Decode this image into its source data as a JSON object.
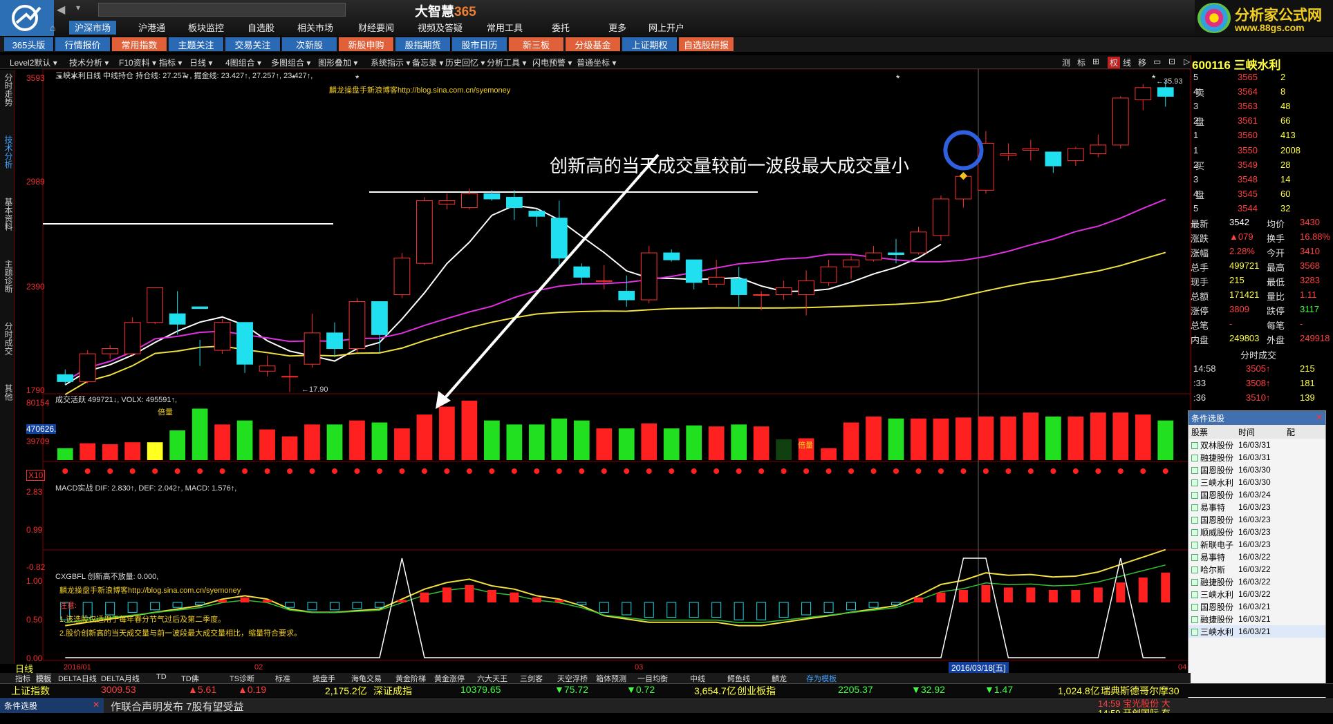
{
  "app": {
    "title_a": "大智慧",
    "title_b": "365"
  },
  "brand": {
    "line1": "分析家公式网",
    "line2": "www.88gs.com"
  },
  "top_menu": [
    "沪深市场",
    "沪港通",
    "板块监控",
    "自选股",
    "相关市场",
    "财经要闻",
    "视频及答疑",
    "常用工具",
    "委托",
    "更多",
    "网上开户"
  ],
  "tabs": [
    {
      "label": "365头版",
      "style": "b"
    },
    {
      "label": "行情报价",
      "style": "b"
    },
    {
      "label": "常用指数",
      "style": "o"
    },
    {
      "label": "主题关注",
      "style": "b"
    },
    {
      "label": "交易关注",
      "style": "b"
    },
    {
      "label": "次新股",
      "style": "b"
    },
    {
      "label": "新股申购",
      "style": "o"
    },
    {
      "label": "股指期货",
      "style": "b"
    },
    {
      "label": "股市日历",
      "style": "b"
    },
    {
      "label": "新三板",
      "style": "o"
    },
    {
      "label": "分级基金",
      "style": "o"
    },
    {
      "label": "上证期权",
      "style": "b"
    },
    {
      "label": "自选股研报",
      "style": "o"
    }
  ],
  "toolbar": [
    "Level2默认",
    "技术分析",
    "F10资料",
    "指标",
    "日线",
    "4图组合",
    "多图组合",
    "图形叠加",
    "系统指示",
    "备忘录",
    "历史回忆",
    "分析工具",
    "闪电预警",
    "普通坐标"
  ],
  "toolbar_right": [
    "测",
    "标",
    "⊞",
    "权",
    "线",
    "移",
    "▭",
    "⊡",
    "▷"
  ],
  "side_tabs": [
    "分时走势",
    "技术分析",
    "基本资料",
    "主题诊断",
    "分时成交",
    "其他"
  ],
  "price_chart": {
    "header": "三峡水利日线 中线持仓  持仓线: 27.257↑, 掘金线: 23.427↑, 27.257↑, 23.427↑,",
    "blog": "麟龙操盘手新浪博客http://blog.sina.com.cn/syemoney",
    "annotation": "创新高的当天成交量较前一波段最大成交量小",
    "y_labels": [
      "3593",
      "2989",
      "2390",
      "1790"
    ],
    "low_label": "←17.90",
    "high_label": "←35.93"
  },
  "volume_chart": {
    "header": "成交活跃 499721↓, VOLX: 495591↑,",
    "y_labels": [
      "80154",
      "470626.",
      "39709",
      "X10"
    ],
    "marker": "倍量",
    "marker2": "倍量"
  },
  "macd_chart": {
    "header": "MACD实战 DIF: 2.830↑, DEF: 2.042↑, MACD: 1.576↑,",
    "y_labels": [
      "2.83",
      "0.99",
      "-0.82"
    ]
  },
  "signal_chart": {
    "header": "CXGBFL 创新高不放量: 0.000,",
    "blog": "麟龙操盘手新浪博客http://blog.sina.com.cn/syemoney",
    "notes": [
      "注意:",
      "1.该选股仅适用于每年春分节气过后及第二季度。",
      "2.股价创新高的当天成交量与前一波段最大成交量相比，缩量符合要求。"
    ],
    "y_labels": [
      "1.00",
      "0.50",
      "0.00"
    ]
  },
  "date_axis": {
    "label": "日线",
    "ticks": [
      "2016/01",
      "02",
      "03"
    ],
    "cursor": "2016/03/18[五]",
    "end": "04"
  },
  "chart_data": {
    "type": "candlestick",
    "title": "三峡水利日线",
    "ylim": [
      17.9,
      35.93
    ],
    "candles": [
      [
        19.0,
        19.3,
        18.4,
        18.6
      ],
      [
        18.6,
        20.4,
        18.5,
        20.2
      ],
      [
        20.2,
        20.7,
        19.9,
        20.5
      ],
      [
        20.2,
        22.3,
        20.1,
        22.0
      ],
      [
        22.0,
        24.0,
        21.9,
        24.0
      ],
      [
        22.5,
        23.8,
        21.3,
        21.9
      ],
      [
        22.9,
        21.0,
        19.5,
        22.8
      ],
      [
        20.4,
        22.2,
        20.2,
        22.0
      ],
      [
        22.0,
        21.2,
        19.1,
        19.6
      ],
      [
        19.2,
        20.1,
        18.9,
        19.5
      ],
      [
        18.9,
        19.6,
        18.0,
        18.9
      ],
      [
        19.6,
        22.5,
        19.4,
        21.4
      ],
      [
        21.4,
        22.0,
        20.0,
        20.5
      ],
      [
        20.5,
        23.4,
        20.3,
        23.2
      ],
      [
        23.2,
        23.0,
        20.3,
        21.3
      ],
      [
        23.6,
        26.0,
        23.4,
        25.7
      ],
      [
        25.4,
        29.2,
        25.3,
        29.0
      ],
      [
        28.8,
        29.4,
        28.5,
        29.0
      ],
      [
        28.6,
        29.7,
        28.5,
        29.4
      ],
      [
        29.4,
        29.6,
        29.0,
        29.1
      ],
      [
        29.2,
        29.6,
        27.9,
        28.6
      ],
      [
        28.4,
        28.5,
        27.5,
        28.1
      ],
      [
        28.0,
        29.0,
        25.2,
        25.7
      ],
      [
        25.2,
        25.4,
        24.2,
        24.6
      ],
      [
        24.4,
        25.3,
        23.9,
        24.4
      ],
      [
        23.8,
        24.7,
        22.9,
        23.3
      ],
      [
        23.3,
        26.4,
        23.1,
        26.0
      ],
      [
        26.0,
        26.2,
        25.5,
        25.6
      ],
      [
        25.6,
        25.5,
        23.9,
        24.3
      ],
      [
        24.2,
        25.6,
        24.0,
        24.6
      ],
      [
        24.5,
        25.2,
        22.9,
        23.6
      ],
      [
        23.6,
        23.8,
        22.7,
        23.6
      ],
      [
        23.6,
        24.4,
        23.3,
        24.0
      ],
      [
        23.6,
        25.0,
        22.4,
        24.4
      ],
      [
        24.3,
        25.6,
        24.1,
        25.2
      ],
      [
        25.2,
        25.8,
        24.5,
        25.6
      ],
      [
        25.6,
        26.4,
        25.5,
        26.0
      ],
      [
        26.0,
        26.8,
        25.4,
        25.9
      ],
      [
        26.0,
        27.5,
        25.9,
        27.2
      ],
      [
        27.0,
        29.3,
        26.7,
        29.1
      ],
      [
        29.1,
        30.4,
        28.6,
        30.4
      ],
      [
        29.6,
        33.0,
        29.4,
        32.3
      ],
      [
        31.6,
        32.3,
        31.3,
        31.7
      ],
      [
        31.9,
        32.5,
        31.3,
        32.0
      ],
      [
        31.8,
        31.8,
        30.6,
        31.0
      ],
      [
        31.3,
        32.1,
        31.0,
        32.0
      ],
      [
        31.7,
        32.8,
        31.5,
        32.2
      ],
      [
        32.2,
        35.0,
        32.0,
        34.9
      ],
      [
        34.8,
        35.7,
        34.2,
        35.5
      ],
      [
        35.5,
        35.93,
        34.4,
        35.0
      ]
    ],
    "volume": [
      12,
      17,
      16,
      18,
      18,
      30,
      52,
      36,
      40,
      31,
      24,
      36,
      36,
      40,
      38,
      32,
      46,
      54,
      60,
      40,
      36,
      36,
      42,
      40,
      32,
      32,
      37,
      32,
      35,
      34,
      36,
      34,
      21,
      22,
      12,
      38,
      44,
      42,
      42,
      42,
      43,
      44,
      44,
      48,
      44,
      44,
      48,
      48,
      46,
      40
    ],
    "macd_hist": [
      -0.7,
      -0.6,
      -0.5,
      -0.4,
      -0.3,
      -0.2,
      -0.1,
      0.1,
      0.2,
      0.1,
      -0.2,
      -0.3,
      -0.3,
      -0.25,
      -0.2,
      0.1,
      0.4,
      0.6,
      0.7,
      0.5,
      0.4,
      0.2,
      0.1,
      -0.1,
      -0.4,
      -0.5,
      -0.6,
      -0.6,
      -0.6,
      -0.6,
      -0.7,
      -0.7,
      -0.6,
      -0.5,
      -0.4,
      -0.3,
      -0.2,
      -0.1,
      0.2,
      0.4,
      0.5,
      0.7,
      0.6,
      0.6,
      0.5,
      0.5,
      0.6,
      0.8,
      1.0,
      1.2
    ],
    "signal": [
      0,
      0,
      0,
      0,
      0,
      0,
      0,
      0,
      0,
      0,
      0,
      0,
      0,
      0,
      0,
      1,
      0,
      0,
      0,
      0,
      0,
      0,
      0,
      0,
      0,
      0,
      0,
      0,
      0,
      0,
      0,
      0,
      0,
      0,
      0,
      0,
      0,
      0,
      0,
      0,
      1,
      1,
      0,
      0,
      0,
      0,
      0,
      1,
      0,
      0
    ]
  },
  "quote": {
    "code": "600116 三峡水利",
    "sell": [
      [
        "5",
        "3565",
        "2"
      ],
      [
        "4",
        "3564",
        "8"
      ],
      [
        "3",
        "3563",
        "48"
      ],
      [
        "2",
        "3561",
        "66"
      ],
      [
        "1",
        "3560",
        "413"
      ]
    ],
    "buy": [
      [
        "1",
        "3550",
        "2008"
      ],
      [
        "2",
        "3549",
        "28"
      ],
      [
        "3",
        "3548",
        "14"
      ],
      [
        "4",
        "3545",
        "60"
      ],
      [
        "5",
        "3544",
        "32"
      ]
    ],
    "sell_label": "卖 盘",
    "buy_label": "买 盘",
    "stats": [
      [
        "最新",
        "3542",
        "均价",
        "3430"
      ],
      [
        "涨跌",
        "▲079",
        "换手",
        "16.88%"
      ],
      [
        "涨幅",
        "2.28%",
        "今开",
        "3410"
      ],
      [
        "总手",
        "499721",
        "最高",
        "3568"
      ],
      [
        "现手",
        "215",
        "最低",
        "3283"
      ],
      [
        "总额",
        "171421",
        "量比",
        "1.11"
      ],
      [
        "涨停",
        "3809",
        "跌停",
        "3117"
      ],
      [
        "总笔",
        "-",
        "每笔",
        "-"
      ],
      [
        "内盘",
        "249803",
        "外盘",
        "249918"
      ]
    ],
    "ticks_header": "分时成交",
    "ticks": [
      [
        "14:58",
        "3505↑",
        "215"
      ],
      [
        ":33",
        "3508↑",
        "181"
      ],
      [
        ":36",
        "3510↑",
        "139"
      ]
    ]
  },
  "cond_panel": {
    "title": "条件选股",
    "cols": [
      "股票",
      "时间",
      "配"
    ],
    "rows": [
      [
        "双林股份",
        "16/03/31"
      ],
      [
        "融捷股份",
        "16/03/31"
      ],
      [
        "国恩股份",
        "16/03/30"
      ],
      [
        "三峡水利",
        "16/03/30"
      ],
      [
        "国恩股份",
        "16/03/24"
      ],
      [
        "易事特",
        "16/03/23"
      ],
      [
        "国恩股份",
        "16/03/23"
      ],
      [
        "顺威股份",
        "16/03/23"
      ],
      [
        "新联电子",
        "16/03/23"
      ],
      [
        "易事特",
        "16/03/22"
      ],
      [
        "哈尔斯",
        "16/03/22"
      ],
      [
        "融捷股份",
        "16/03/22"
      ],
      [
        "三峡水利",
        "16/03/22"
      ],
      [
        "国恩股份",
        "16/03/21"
      ],
      [
        "融捷股份",
        "16/03/21"
      ],
      [
        "三峡水利",
        "16/03/21"
      ]
    ]
  },
  "bottom_tabs": [
    "指标",
    "模板",
    "DELTA日线",
    "DELTA月线",
    "TD",
    "TD佛",
    "TS诊断",
    "标准",
    "操盘手",
    "海龟交易",
    "黄金阶梯",
    "黄金涨停",
    "六大天王",
    "三剑客",
    "天空浮桥",
    "箱体预测",
    "一目均衡",
    "中线",
    "鳄鱼线",
    "麟龙",
    "存为模板"
  ],
  "index_bar": [
    {
      "t": "上证指数",
      "c": "#ffff40"
    },
    {
      "t": "3009.53",
      "c": "#ff4040"
    },
    {
      "t": "▲5.61",
      "c": "#ff4040"
    },
    {
      "t": "▲0.19",
      "c": "#ff4040"
    },
    {
      "t": "2,175.2亿",
      "c": "#ffff40"
    },
    {
      "t": "深证成指",
      "c": "#ffff40"
    },
    {
      "t": "10379.65",
      "c": "#40ff40"
    },
    {
      "t": "▼75.72",
      "c": "#40ff40"
    },
    {
      "t": "▼0.72",
      "c": "#40ff40"
    },
    {
      "t": "3,654.7亿",
      "c": "#ffff40"
    },
    {
      "t": "创业板指",
      "c": "#ffff40"
    },
    {
      "t": "2205.37",
      "c": "#40ff40"
    },
    {
      "t": "▼32.92",
      "c": "#40ff40"
    },
    {
      "t": "▼1.47",
      "c": "#40ff40"
    },
    {
      "t": "1,024.8亿",
      "c": "#ffff40"
    },
    {
      "t": "瑞典斯德哥尔摩30",
      "c": "#ffff40"
    }
  ],
  "news": {
    "left_tab": "条件选股",
    "text": "作联合声明发布 7股有望受益",
    "right1": "14:59 宝光股份 大",
    "right2": "14:59 开创国际 有"
  }
}
